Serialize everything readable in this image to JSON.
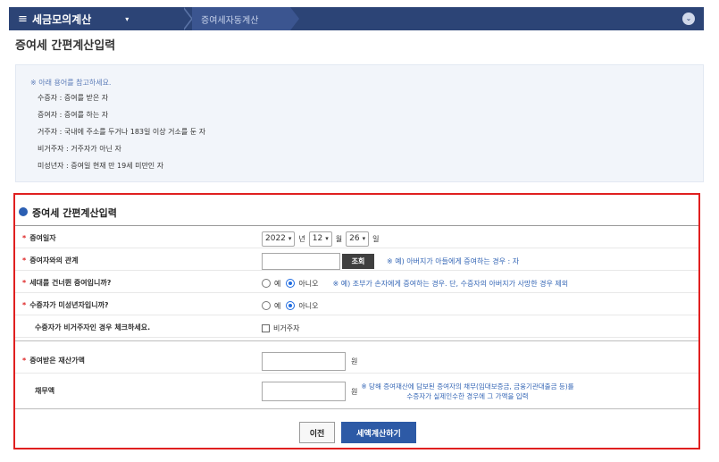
{
  "nav": {
    "menu_icon": "hamburger-icon",
    "app_title": "세금모의계산",
    "caret": "▾",
    "breadcrumb": "증여세자동계산",
    "collapse_icon": "chevron-down-circle-icon",
    "collapse_glyph": "⌄"
  },
  "page": {
    "title": "증여세 간편계산입력"
  },
  "notice": {
    "heading": "※ 아래 용어를 참고하세요.",
    "lines": [
      "수증자 : 증여를 받은 자",
      "증여자 : 증여를 하는 자",
      "거주자 : 국내에 주소를 두거나 183일 이상 거소를 둔 자",
      "비거주자 : 거주자가 아닌 자",
      "미성년자 : 증여일 현재 만 19세 미만인 자"
    ]
  },
  "form": {
    "title": "증여세 간편계산입력",
    "star": "*",
    "date": {
      "label": "증여일자",
      "year": "2022",
      "year_unit": "년",
      "month": "12",
      "month_unit": "월",
      "day": "26",
      "day_unit": "일",
      "chevron": "▾"
    },
    "relation": {
      "label": "증여자와의 관계",
      "value": "",
      "search_button": "조회",
      "hint": "※ 예) 아버지가 아들에게 증여하는 경우 : 자"
    },
    "generation_skip": {
      "label": "세대를 건너뛴 증여입니까?",
      "yes": "예",
      "no": "아니오",
      "selected": "no",
      "hint": "※ 예) 조부가 손자에게 증여하는 경우. 단, 수증자의 아버지가 사망한 경우 제외"
    },
    "minor": {
      "label": "수증자가 미성년자입니까?",
      "yes": "예",
      "no": "아니오",
      "selected": "no"
    },
    "non_resident": {
      "label": "수증자가 비거주자인 경우 체크하세요.",
      "checkbox_label": "비거주자",
      "checked": false
    },
    "property_value": {
      "label": "증여받은 재산가액",
      "value": "",
      "unit": "원"
    },
    "debt": {
      "label": "채무액",
      "value": "",
      "unit": "원",
      "hint_line1": "※ 당해 증여재산에 담보된 증여자의 채무(임대보증금, 금융기관대출금 등)를",
      "hint_line2": "수증자가 실제인수한 경우에 그 가액을 입력"
    },
    "buttons": {
      "prev": "이전",
      "calculate": "세액계산하기"
    }
  },
  "colors": {
    "nav_bg": "#2c4476",
    "highlight_border": "#e02020",
    "primary_button": "#2d5aa6",
    "hint_text": "#3365b5",
    "required_star": "#d22222"
  }
}
